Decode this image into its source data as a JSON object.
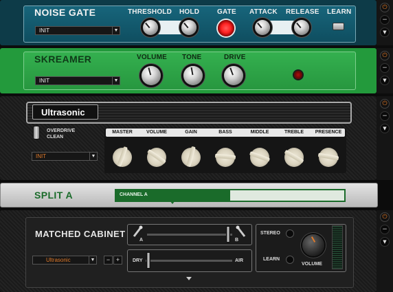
{
  "noise_gate": {
    "title": "NOISE GATE",
    "preset": "INIT",
    "labels": {
      "threshold": "THRESHOLD",
      "hold": "HOLD",
      "gate": "GATE",
      "attack": "ATTACK",
      "release": "RELEASE",
      "learn": "LEARN"
    },
    "colors": {
      "panel": "#14596d",
      "led_gate": "#ff2222"
    }
  },
  "skreamer": {
    "title": "SKREAMER",
    "preset": "INIT",
    "labels": {
      "volume": "VOLUME",
      "tone": "TONE",
      "drive": "DRIVE"
    },
    "colors": {
      "panel": "#2e9e45"
    }
  },
  "amp": {
    "name": "Ultrasonic",
    "switch_top": "OVERDRIVE",
    "switch_bottom": "CLEAN",
    "preset": "INIT",
    "controls": [
      "MASTER",
      "VOLUME",
      "GAIN",
      "BASS",
      "MIDDLE",
      "TREBLE",
      "PRESENCE"
    ]
  },
  "split": {
    "title": "SPLIT A",
    "channel_a": "CHANNEL A",
    "colors": {
      "panel": "#cfcfcf",
      "accent": "#1a6b2a"
    }
  },
  "cabinet": {
    "title": "MATCHED CABINET",
    "preset": "Ultrasonic",
    "minus": "−",
    "plus": "+",
    "mic_a": "A",
    "mic_b": "B",
    "dry": "DRY",
    "air": "AIR",
    "stereo": "STEREO",
    "learn": "LEARN",
    "volume": "VOLUME"
  },
  "icons": {
    "power": "⏻",
    "minus": "−",
    "down": "▼",
    "dropdown": "▼"
  }
}
